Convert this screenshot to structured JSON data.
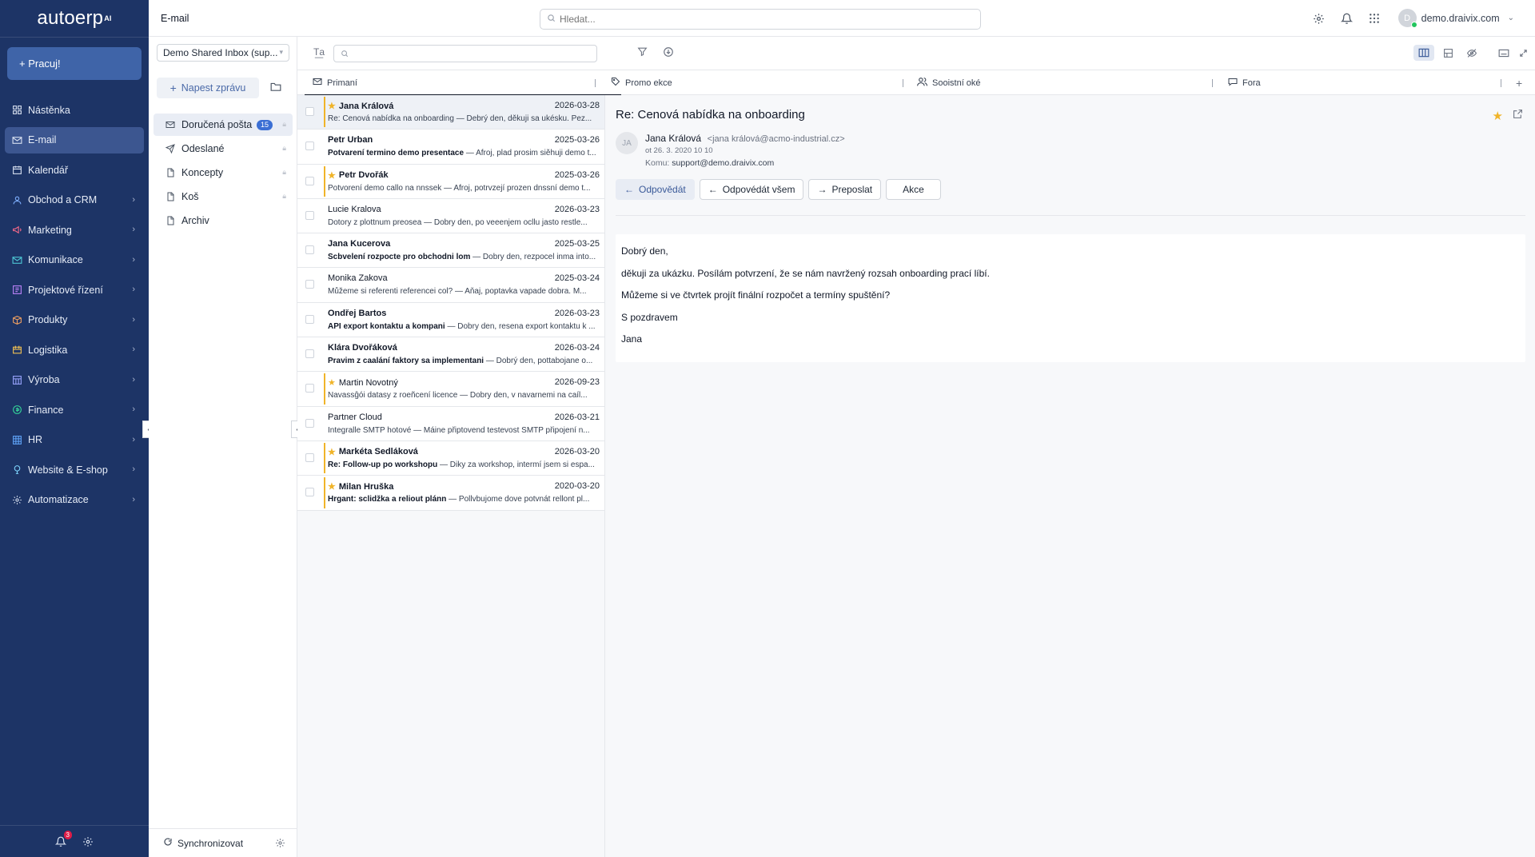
{
  "app": {
    "logo": "autoerp",
    "logo_sup": "AI"
  },
  "nav": {
    "cta_label": "+ Pracuj!",
    "items": [
      {
        "label": "Nástěnka",
        "icon": "dashboard-icon",
        "chevron": false
      },
      {
        "label": "E-mail",
        "icon": "mail-icon",
        "chevron": false,
        "active": true
      },
      {
        "label": "Kalendář",
        "icon": "calendar-icon",
        "chevron": false
      },
      {
        "label": "Obchod a CRM",
        "icon": "user-icon",
        "chevron": true
      },
      {
        "label": "Marketing",
        "icon": "megaphone-icon",
        "chevron": true
      },
      {
        "label": "Komunikace",
        "icon": "chat-icon",
        "chevron": true
      },
      {
        "label": "Projektové řízení",
        "icon": "project-icon",
        "chevron": true
      },
      {
        "label": "Produkty",
        "icon": "box-icon",
        "chevron": true
      },
      {
        "label": "Logistika",
        "icon": "truck-icon",
        "chevron": true
      },
      {
        "label": "Výroba",
        "icon": "factory-icon",
        "chevron": true
      },
      {
        "label": "Finance",
        "icon": "coin-icon",
        "chevron": true
      },
      {
        "label": "HR",
        "icon": "hr-icon",
        "chevron": true
      },
      {
        "label": "Website & E-shop",
        "icon": "globe-icon",
        "chevron": true
      },
      {
        "label": "Automatizace",
        "icon": "gear-icon",
        "chevron": true
      }
    ],
    "notification_count": "3"
  },
  "topbar": {
    "breadcrumb": "E-mail",
    "search_placeholder": "Hledat...",
    "user": "demo.draivix.com",
    "avatar_initial": "D"
  },
  "folders": {
    "mailbox": "Demo Shared Inbox (sup...",
    "compose_label": "Napest zprávu",
    "items": [
      {
        "label": "Doručená pošta",
        "count": "15",
        "icon": "inbox-icon",
        "active": true
      },
      {
        "label": "Odeslané",
        "icon": "send-icon"
      },
      {
        "label": "Koncepty",
        "icon": "draft-icon"
      },
      {
        "label": "Koš",
        "icon": "trash-icon"
      },
      {
        "label": "Archiv",
        "icon": "archive-icon"
      }
    ],
    "sync_label": "Synchronizovat"
  },
  "list_search": {
    "placeholder": ""
  },
  "tabs": [
    {
      "label": "Primaní",
      "icon": "mail-icon"
    },
    {
      "label": "Promo ekce",
      "icon": "tag-icon"
    },
    {
      "label": "Sooistní oké",
      "icon": "users-icon"
    },
    {
      "label": "Fora",
      "icon": "forum-icon"
    }
  ],
  "messages": [
    {
      "sender": "Jana Králová",
      "date": "2026-03-28",
      "subject": "Re: Cenová nabídka na onboarding",
      "preview": "— Debrý den, děkuji sa ukésku. Pez...",
      "starred": true,
      "bold": true,
      "subject_bold": false,
      "selected": true
    },
    {
      "sender": "Petr Urban",
      "date": "2025-03-26",
      "subject": "Potvarení termino demo presentace",
      "preview": "— Afroj, plad prosim siěhuji demo t...",
      "starred": false,
      "bold": true,
      "subject_bold": true
    },
    {
      "sender": "Petr Dvořák",
      "date": "2025-03-26",
      "subject": "Potvorení demo callo na nnssek",
      "preview": "— Afroj, potrvzejí prozen dnssní demo t...",
      "starred": true,
      "bold": true,
      "subject_bold": false
    },
    {
      "sender": "Lucie Kralova",
      "date": "2026-03-23",
      "subject": "Dotory z plottnum preosea",
      "preview": "— Dobry den, po veeenjem ocllu jasto restle...",
      "starred": false,
      "bold": false,
      "subject_bold": false
    },
    {
      "sender": "Jana Kucerova",
      "date": "2025-03-25",
      "subject": "Scbvelení rozpocte pro obchodni lom",
      "preview": "— Dobry den, rezpocel inma into...",
      "starred": false,
      "bold": true,
      "subject_bold": true
    },
    {
      "sender": "Monika Zakova",
      "date": "2025-03-24",
      "subject": "Můžeme si referenti referencei col?",
      "preview": "— Aňaj, poptavka vapade dobra. M...",
      "starred": false,
      "bold": false,
      "subject_bold": false
    },
    {
      "sender": "Ondřej Bartos",
      "date": "2026-03-23",
      "subject": "API export kontaktu a kompani",
      "preview": "— Dobry den, resena export kontaktu k ...",
      "starred": false,
      "bold": true,
      "subject_bold": true
    },
    {
      "sender": "Klára Dvořáková",
      "date": "2026-03-24",
      "subject": "Pravim z caalání faktory sa implementani",
      "preview": "— Dobrý den, pottabojane o...",
      "starred": false,
      "bold": true,
      "subject_bold": true
    },
    {
      "sender": "Martin Novotný",
      "date": "2026-09-23",
      "subject": "Navassĝói datasy z roeñcení licence",
      "preview": "— Dobry den, v navarnemi na caíl...",
      "starred": true,
      "bold": false,
      "subject_bold": false
    },
    {
      "sender": "Partner Cloud",
      "date": "2026-03-21",
      "subject": "Integralle SMTP hotové",
      "preview": "— Máine připtovend testevost SMTP připojení n...",
      "starred": false,
      "bold": false,
      "subject_bold": false
    },
    {
      "sender": "Markéta Sedláková",
      "date": "2026-03-20",
      "subject": "Re: Follow-up po workshopu",
      "preview": "— Diky za workshop, intermí jsem si espa...",
      "starred": true,
      "bold": true,
      "subject_bold": true
    },
    {
      "sender": "Milan Hruška",
      "date": "2020-03-20",
      "subject": "Hrgant: sclidžka a reliout plánn",
      "preview": "— Pollvbujome dove potvnát rellont pl...",
      "starred": true,
      "bold": true,
      "subject_bold": true
    }
  ],
  "reader": {
    "subject": "Re: Cenová nabídka na onboarding",
    "avatar_initials": "JA",
    "from_name": "Jana Králová",
    "from_email": "<jana králová@acmo-industrial.cz>",
    "date": "ot 26. 3. 2020 10 10",
    "to_label": "Komu:",
    "to_address": "support@demo.draivix.com",
    "actions": {
      "reply": "Odpovědát",
      "reply_all": "Odpovédát všem",
      "forward": "Preposlat",
      "more": "Akce"
    },
    "body": [
      "Dobrý den,",
      "děkuji za ukázku. Posílám potvrzení, že se nám navržený rozsah onboarding prací líbí.",
      "Můžeme si ve čtvrtek projít finální rozpočet a termíny spuštění?",
      "S pozdravem",
      "Jana"
    ]
  },
  "colors": {
    "nav_bg": "#1d3466",
    "accent": "#3b6fd4",
    "star": "#f0b429"
  }
}
